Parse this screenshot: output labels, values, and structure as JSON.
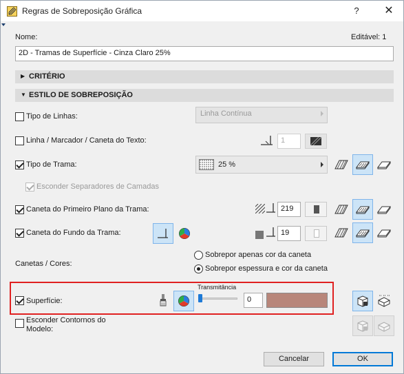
{
  "window": {
    "title": "Regras de Sobreposição Gráfica",
    "help": "?",
    "close": "✕"
  },
  "name": {
    "label": "Nome:",
    "editable_label": "Editável: 1",
    "value": "2D - Tramas de Superfície - Cinza Claro 25%"
  },
  "sections": {
    "criterio": "CRITÉRIO",
    "estilo": "ESTILO DE SOBREPOSIÇÃO"
  },
  "rows": {
    "tipo_linhas": {
      "label": "Tipo de Linhas:",
      "checked": false,
      "dropdown": "Linha Contínua"
    },
    "linha_marcador": {
      "label": "Linha / Marcador / Caneta do Texto:",
      "checked": false,
      "pen": "1"
    },
    "tipo_trama": {
      "label": "Tipo de Trama:",
      "checked": true,
      "dropdown": "25 %"
    },
    "esconder_separadores": {
      "label": "Esconder Separadores de Camadas",
      "checked": true
    },
    "caneta_primeiro": {
      "label": "Caneta do Primeiro Plano da Trama:",
      "checked": true,
      "pen": "219"
    },
    "caneta_fundo": {
      "label": "Caneta do Fundo da Trama:",
      "checked": true,
      "pen": "19"
    }
  },
  "canetas": {
    "label": "Canetas / Cores:",
    "option1": "Sobrepor apenas cor da caneta",
    "option2": "Sobrepor espessura e cor da caneta",
    "selected": 2
  },
  "superficie": {
    "label": "Superfície:",
    "checked": true,
    "transmitancia_label": "Transmitância",
    "transmitancia_value": "0",
    "color": "#b8867a"
  },
  "esconder_contornos": {
    "label_line1": "Esconder Contornos do",
    "label_line2": "Modelo:",
    "checked": false
  },
  "buttons": {
    "cancel": "Cancelar",
    "ok": "OK"
  },
  "colors": {
    "accent": "#0078d7",
    "highlight": "#e02020",
    "selected_bg": "#cce4f7"
  }
}
